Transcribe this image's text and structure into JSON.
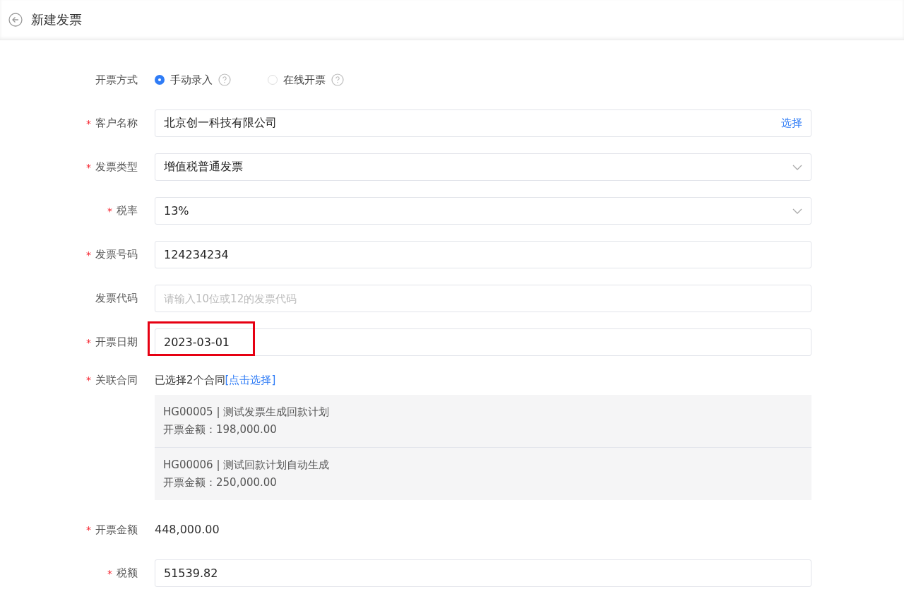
{
  "header": {
    "title": "新建发票"
  },
  "form": [
    {
      "kind": "radio",
      "label": "开票方式",
      "options": [
        {
          "label": "手动录入",
          "selected": true
        },
        {
          "label": "在线开票",
          "selected": false
        }
      ]
    },
    {
      "kind": "picker",
      "label": "客户名称",
      "required_mark": "*",
      "value": "北京创一科技有限公司",
      "action": "选择"
    },
    {
      "kind": "select",
      "label": "发票类型",
      "required_mark": "*",
      "value": "增值税普通发票"
    },
    {
      "kind": "select",
      "label": "税率",
      "required_mark": "*",
      "value": "13%"
    },
    {
      "kind": "input",
      "label": "发票号码",
      "required_mark": "*",
      "value": "124234234"
    },
    {
      "kind": "input",
      "label": "发票代码",
      "placeholder": "请输入10位或12的发票代码"
    },
    {
      "kind": "input",
      "label": "开票日期",
      "required_mark": "*",
      "value": "2023-03-01",
      "highlighted": true
    },
    {
      "kind": "contracts",
      "label": "关联合同",
      "required_mark": "*",
      "summary": "已选择2个合同",
      "link": "[点击选择]",
      "items": [
        {
          "title": "HG00005 | 测试发票生成回款计划",
          "amount": "开票金额：198,000.00"
        },
        {
          "title": "HG00006 | 测试回款计划自动生成",
          "amount": "开票金额：250,000.00"
        }
      ]
    },
    {
      "kind": "text",
      "label": "开票金额",
      "required_mark": "*",
      "value": "448,000.00"
    },
    {
      "kind": "input",
      "label": "税额",
      "required_mark": "*",
      "value": "51539.82"
    }
  ]
}
